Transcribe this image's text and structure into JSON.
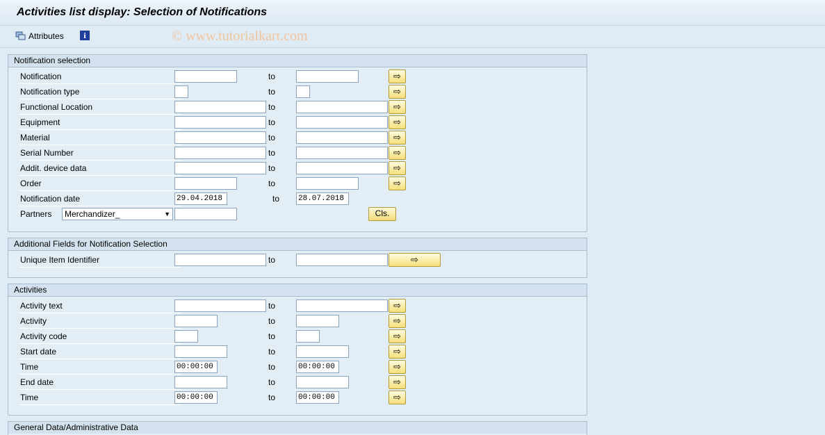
{
  "title": "Activities list display: Selection of Notifications",
  "toolbar": {
    "attributes_label": "Attributes",
    "watermark": "© www.tutorialkart.com"
  },
  "notification_selection": {
    "header": "Notification selection",
    "to_label": "to",
    "rows": [
      {
        "label": "Notification",
        "from": "",
        "to": ""
      },
      {
        "label": "Notification type",
        "from": "",
        "to": ""
      },
      {
        "label": "Functional Location",
        "from": "",
        "to": ""
      },
      {
        "label": "Equipment",
        "from": "",
        "to": ""
      },
      {
        "label": "Material",
        "from": "",
        "to": ""
      },
      {
        "label": "Serial Number",
        "from": "",
        "to": ""
      },
      {
        "label": "Addit. device data",
        "from": "",
        "to": ""
      },
      {
        "label": "Order",
        "from": "",
        "to": ""
      },
      {
        "label": "Notification date",
        "from": "29.04.2018",
        "to": "28.07.2018"
      }
    ],
    "partners": {
      "label": "Partners",
      "dropdown_value": "Merchandizer_",
      "value": "",
      "cls_button": "Cls."
    }
  },
  "additional_fields": {
    "header": "Additional Fields for Notification Selection",
    "rows": [
      {
        "label": "Unique Item Identifier",
        "from": "",
        "to": ""
      }
    ]
  },
  "activities": {
    "header": "Activities",
    "rows": [
      {
        "label": "Activity text",
        "from": "",
        "to": ""
      },
      {
        "label": "Activity",
        "from": "",
        "to": ""
      },
      {
        "label": "Activity code",
        "from": "",
        "to": ""
      },
      {
        "label": "Start date",
        "from": "",
        "to": ""
      },
      {
        "label": "Time",
        "from": "00:00:00",
        "to": "00:00:00"
      },
      {
        "label": "End date",
        "from": "",
        "to": ""
      },
      {
        "label": "Time",
        "from": "00:00:00",
        "to": "00:00:00"
      }
    ]
  },
  "general_data": {
    "header": "General Data/Administrative Data"
  },
  "icons": {
    "attributes": "attributes-icon",
    "info": "info-icon",
    "multiple_selection": "multiple-selection-arrow-icon",
    "dropdown": "chevron-down-icon"
  },
  "colors": {
    "background": "#dfebf5",
    "group_header": "#d4e2ef",
    "button_yellow": "#f4e07a"
  }
}
